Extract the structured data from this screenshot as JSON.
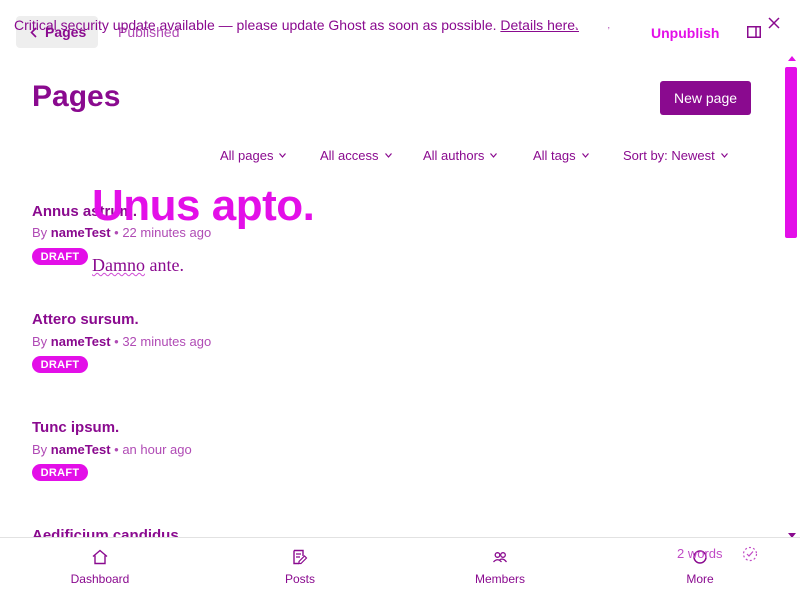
{
  "topbar": {
    "back_label": "Pages",
    "status_label": "Published",
    "banner_text": "Critical security update available — please update Ghost as soon as possible.",
    "banner_link": "Details here.",
    "tiny_dots": "’ ’",
    "unpublish_label": "Unpublish"
  },
  "header": {
    "title": "Pages",
    "new_button": "New page"
  },
  "filters": {
    "pages": "All pages",
    "access": "All access",
    "authors": "All authors",
    "tags": "All tags",
    "sort": "Sort by: Newest"
  },
  "items": [
    {
      "title": "Annus astrum.",
      "by": "By",
      "author": "nameTest",
      "time": "22 minutes ago",
      "badge": "DRAFT"
    },
    {
      "title": "Attero sursum.",
      "by": "By",
      "author": "nameTest",
      "time": "32 minutes ago",
      "badge": "DRAFT"
    },
    {
      "title": "Tunc ipsum.",
      "by": "By",
      "author": "nameTest",
      "time": "an hour ago",
      "badge": "DRAFT"
    },
    {
      "title": "Aedificium candidus."
    }
  ],
  "overlay": {
    "title": "Unus apto.",
    "sub_word": "Damno",
    "sub_rest": " ante."
  },
  "bottom_nav": {
    "dashboard": "Dashboard",
    "posts": "Posts",
    "members": "Members",
    "more": "More",
    "word_count": "2 words"
  },
  "colors": {
    "accent": "#e30fe8",
    "primary": "#8a0a8f",
    "muted": "#b04bb5"
  }
}
